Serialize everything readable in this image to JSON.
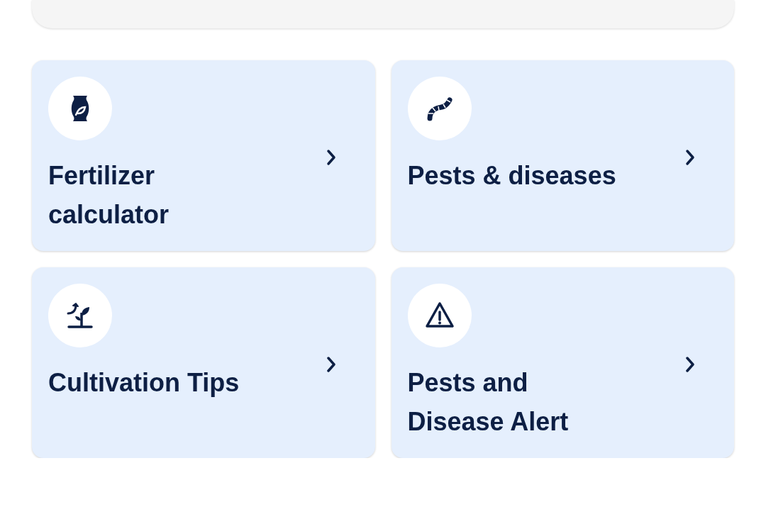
{
  "cards": [
    {
      "kind": "fertilizer",
      "title": "Fertilizer calculator"
    },
    {
      "kind": "pest",
      "title": "Pests & diseases"
    },
    {
      "kind": "cultivation",
      "title": "Cultivation Tips"
    },
    {
      "kind": "alert",
      "title": "Pests and Disease Alert"
    }
  ]
}
